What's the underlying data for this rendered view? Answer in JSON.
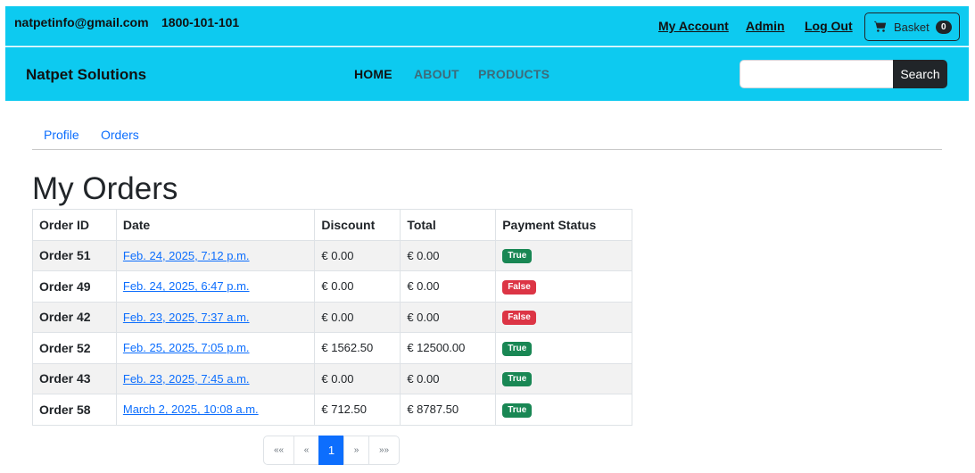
{
  "topbar": {
    "email": "natpetinfo@gmail.com",
    "phone": "1800-101-101",
    "links": [
      "My Account",
      "Admin",
      "Log Out"
    ],
    "basket_label": "Basket",
    "basket_count": "0"
  },
  "navbar": {
    "brand": "Natpet Solutions",
    "links": [
      "HOME",
      "ABOUT",
      "PRODUCTS"
    ],
    "active": "HOME",
    "search_placeholder": "",
    "search_button": "Search"
  },
  "subtabs": [
    "Profile",
    "Orders"
  ],
  "page_title": "My Orders",
  "orders_table": {
    "headers": [
      "Order ID",
      "Date",
      "Discount",
      "Total",
      "Payment Status"
    ],
    "rows": [
      {
        "order_id": "Order 51",
        "date": "Feb. 24, 2025, 7:12 p.m.",
        "discount": "€ 0.00",
        "total": "€ 0.00",
        "status": "True"
      },
      {
        "order_id": "Order 49",
        "date": "Feb. 24, 2025, 6:47 p.m.",
        "discount": "€ 0.00",
        "total": "€ 0.00",
        "status": "False"
      },
      {
        "order_id": "Order 42",
        "date": "Feb. 23, 2025, 7:37 a.m.",
        "discount": "€ 0.00",
        "total": "€ 0.00",
        "status": "False"
      },
      {
        "order_id": "Order 52",
        "date": "Feb. 25, 2025, 7:05 p.m.",
        "discount": "€ 1562.50",
        "total": "€ 12500.00",
        "status": "True"
      },
      {
        "order_id": "Order 43",
        "date": "Feb. 23, 2025, 7:45 a.m.",
        "discount": "€ 0.00",
        "total": "€ 0.00",
        "status": "True"
      },
      {
        "order_id": "Order 58",
        "date": "March 2, 2025, 10:08 a.m.",
        "discount": "€ 712.50",
        "total": "€ 8787.50",
        "status": "True"
      }
    ]
  },
  "pagination": {
    "first": "««",
    "prev": "«",
    "current": "1",
    "next": "»",
    "last": "»»"
  },
  "colors": {
    "header_bg": "#0dcaf0",
    "status_true": "#198754",
    "status_false": "#dc3545",
    "link": "#0d6efd",
    "dark": "#212529"
  },
  "icons": {
    "basket": "cart-icon"
  }
}
